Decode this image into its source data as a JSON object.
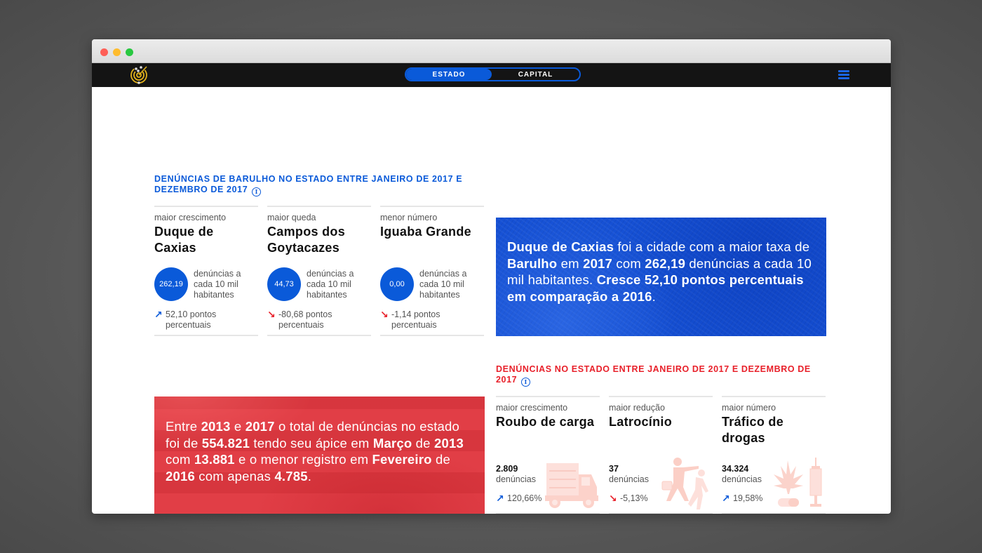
{
  "navbar": {
    "logo_icon": "radar-target-icon",
    "toggle": [
      {
        "label": "ESTADO",
        "active": true
      },
      {
        "label": "CAPITAL",
        "active": false
      }
    ],
    "menu_icon": "hamburger-menu-icon"
  },
  "noise_section": {
    "title": "DENÚNCIAS DE BARULHO NO ESTADO ENTRE JANEIRO DE 2017 E DEZEMBRO DE 2017",
    "info_icon": "i",
    "cards": [
      {
        "label": "maior crescimento",
        "name": "Duque de Caxias",
        "rate": "262,19",
        "rate_text": "denúncias a cada 10 mil habitantes",
        "trend": "up",
        "arrow": "↗",
        "change": "52,10 pontos percentuais"
      },
      {
        "label": "maior queda",
        "name": "Campos dos Goytacazes",
        "rate": "44,73",
        "rate_text": "denúncias a cada 10 mil habitantes",
        "trend": "down",
        "arrow": "↘",
        "change": "-80,68 pontos percentuais"
      },
      {
        "label": "menor número",
        "name": "Iguaba Grande",
        "rate": "0,00",
        "rate_text": "denúncias a cada 10 mil habitantes",
        "trend": "down",
        "arrow": "↘",
        "change": "-1,14 pontos percentuais"
      }
    ],
    "banner": {
      "segments": [
        {
          "t": "Duque de Caxias",
          "b": true
        },
        {
          "t": " foi a cidade com a maior taxa de ",
          "b": false
        },
        {
          "t": "Barulho",
          "b": true
        },
        {
          "t": " em ",
          "b": false
        },
        {
          "t": "2017",
          "b": true
        },
        {
          "t": " com ",
          "b": false
        },
        {
          "t": "262,19",
          "b": true
        },
        {
          "t": " denúncias a cada 10 mil habitantes. ",
          "b": false
        },
        {
          "t": "Cresce 52,10 pontos percentuais em comparação a 2016",
          "b": true
        },
        {
          "t": ".",
          "b": false
        }
      ],
      "color": "#1550d4"
    }
  },
  "total_section": {
    "banner": {
      "segments": [
        {
          "t": "Entre ",
          "b": false
        },
        {
          "t": "2013",
          "b": true
        },
        {
          "t": " e ",
          "b": false
        },
        {
          "t": "2017",
          "b": true
        },
        {
          "t": " o total de denúncias no estado foi de ",
          "b": false
        },
        {
          "t": "554.821",
          "b": true
        },
        {
          "t": " tendo seu ápice em ",
          "b": false
        },
        {
          "t": "Março",
          "b": true
        },
        {
          "t": " de ",
          "b": false
        },
        {
          "t": "2013",
          "b": true
        },
        {
          "t": " com ",
          "b": false
        },
        {
          "t": "13.881",
          "b": true
        },
        {
          "t": " e o menor registro em ",
          "b": false
        },
        {
          "t": "Fevereiro",
          "b": true
        },
        {
          "t": " de ",
          "b": false
        },
        {
          "t": "2016",
          "b": true
        },
        {
          "t": " com apenas ",
          "b": false
        },
        {
          "t": "4.785",
          "b": true
        },
        {
          "t": ".",
          "b": false
        }
      ],
      "color": "#e03840"
    },
    "title": "DENÚNCIAS NO ESTADO ENTRE JANEIRO DE 2017 E DEZEMBRO DE 2017",
    "info_icon": "i",
    "cards": [
      {
        "label": "maior crescimento",
        "name": "Roubo de carga",
        "count": "2.809",
        "unit": "denúncias",
        "trend": "up",
        "arrow": "↗",
        "change": "120,66%",
        "illustration": "truck-icon"
      },
      {
        "label": "maior redução",
        "name": "Latrocínio",
        "count": "37",
        "unit": "denúncias",
        "trend": "down",
        "arrow": "↘",
        "change": "-5,13%",
        "illustration": "robbery-icon"
      },
      {
        "label": "maior número",
        "name": "Tráfico de drogas",
        "count": "34.324",
        "unit": "denúncias",
        "trend": "up",
        "arrow": "↗",
        "change": "19,58%",
        "illustration": "drugs-icon"
      }
    ]
  },
  "colors": {
    "accent_blue": "#0a5ad9",
    "accent_red": "#e8202a",
    "navbar": "#141414"
  }
}
